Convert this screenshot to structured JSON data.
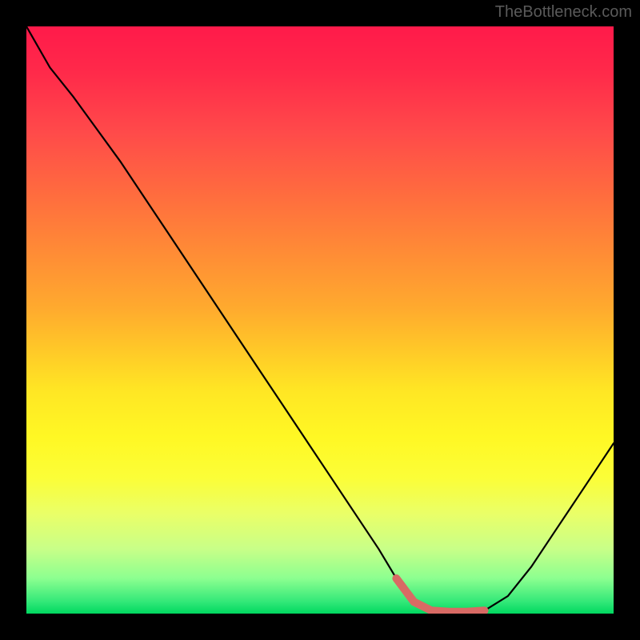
{
  "watermark": "TheBottleneck.com",
  "chart_data": {
    "type": "line",
    "title": "",
    "xlabel": "",
    "ylabel": "",
    "xlim": [
      0,
      100
    ],
    "ylim": [
      0,
      100
    ],
    "series": [
      {
        "name": "bottleneck-curve",
        "x": [
          0,
          4,
          8,
          12,
          16,
          20,
          24,
          28,
          32,
          36,
          40,
          44,
          48,
          52,
          56,
          60,
          63,
          66,
          69,
          72,
          75,
          78,
          82,
          86,
          90,
          94,
          98,
          100
        ],
        "y": [
          100,
          93,
          88,
          82.5,
          77,
          71,
          65,
          59,
          53,
          47,
          41,
          35,
          29,
          23,
          17,
          11,
          6,
          2,
          0.5,
          0.3,
          0.3,
          0.5,
          3,
          8,
          14,
          20,
          26,
          29
        ]
      }
    ],
    "highlight": {
      "name": "optimal-range",
      "x": [
        63,
        66,
        69,
        72,
        75,
        78
      ],
      "y": [
        6,
        2,
        0.5,
        0.3,
        0.3,
        0.5
      ],
      "color": "#d86a64"
    },
    "gradient_stops": [
      {
        "pos": 0,
        "color": "#ff1a4a"
      },
      {
        "pos": 50,
        "color": "#ffaa2e"
      },
      {
        "pos": 75,
        "color": "#fff824"
      },
      {
        "pos": 100,
        "color": "#00d860"
      }
    ]
  }
}
